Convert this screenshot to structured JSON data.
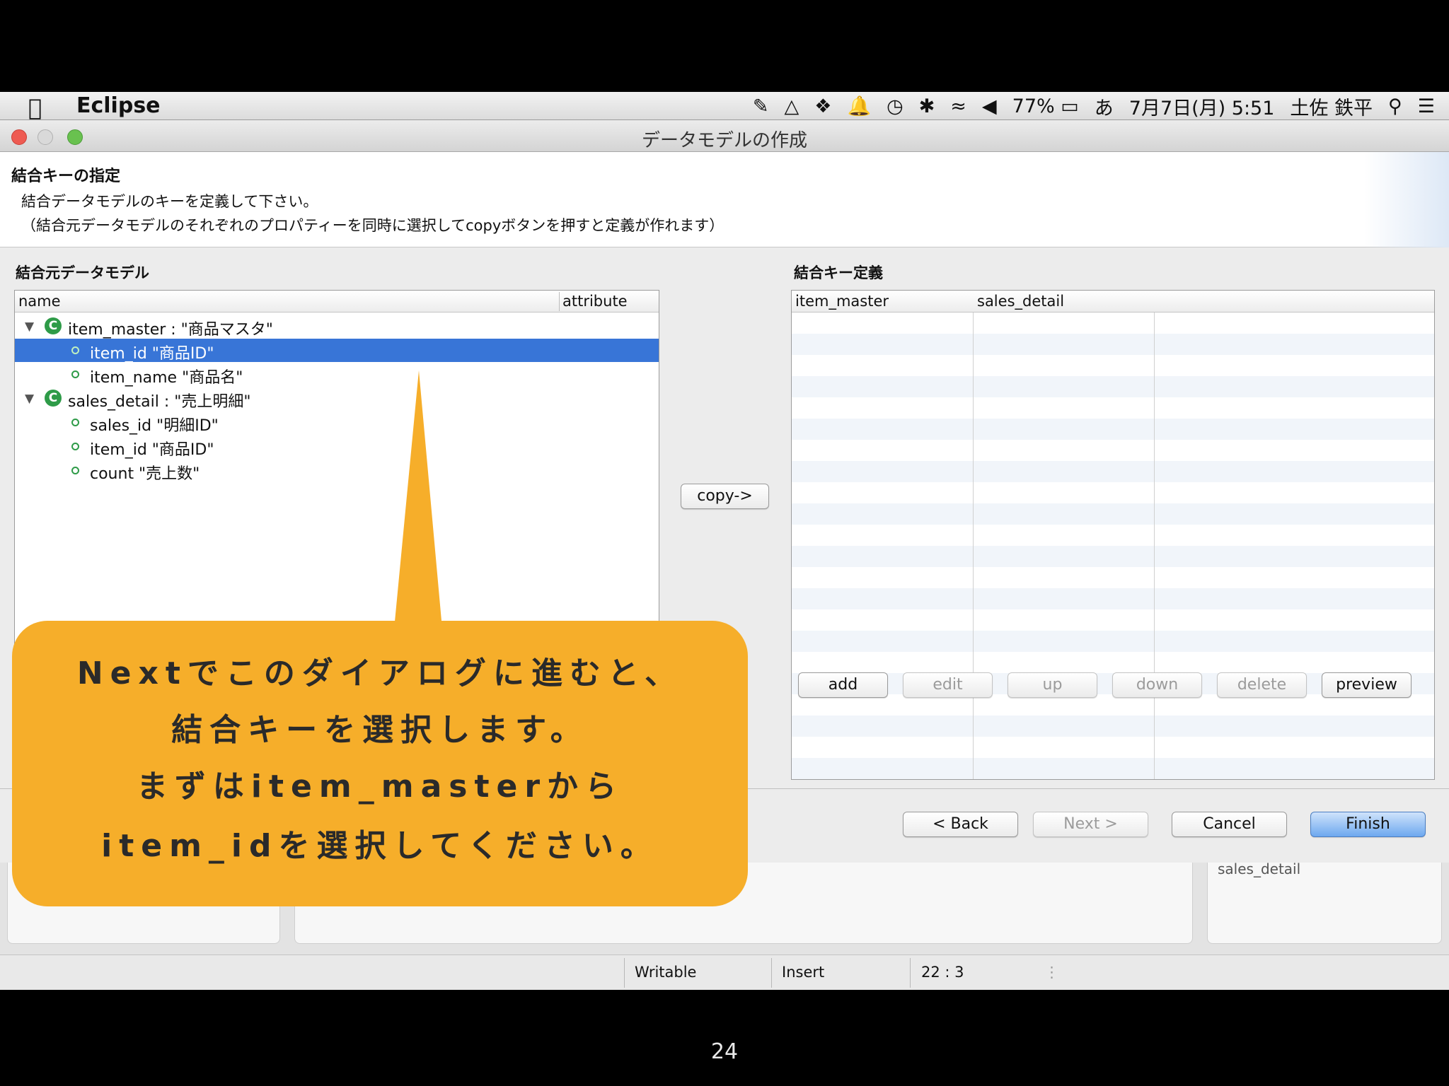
{
  "menubar": {
    "app_name": "Eclipse",
    "battery": "77%",
    "input_method": "あ",
    "datetime": "7月7日(月) 5:51",
    "user": "土佐 鉄平"
  },
  "window": {
    "title": "データモデルの作成"
  },
  "header": {
    "title": "結合キーの指定",
    "desc1": "結合データモデルのキーを定義して下さい。",
    "desc2": "（結合元データモデルのそれぞれのプロパティーを同時に選択してcopyボタンを押すと定義が作れます）"
  },
  "source_panel": {
    "label": "結合元データモデル",
    "columns": [
      "name",
      "attribute"
    ],
    "rows": [
      {
        "text": "item_master : \"商品マスタ\"",
        "kind": "model",
        "selected": false
      },
      {
        "text": "item_id \"商品ID\"",
        "kind": "property",
        "selected": true
      },
      {
        "text": "item_name \"商品名\"",
        "kind": "property",
        "selected": false
      },
      {
        "text": "sales_detail : \"売上明細\"",
        "kind": "model",
        "selected": false
      },
      {
        "text": "sales_id \"明細ID\"",
        "kind": "property",
        "selected": false
      },
      {
        "text": "item_id \"商品ID\"",
        "kind": "property",
        "selected": false
      },
      {
        "text": "count \"売上数\"",
        "kind": "property",
        "selected": false
      }
    ]
  },
  "copy_button": "copy->",
  "key_panel": {
    "label": "結合キー定義",
    "columns": [
      "item_master",
      "sales_detail"
    ]
  },
  "key_buttons": {
    "add": "add",
    "edit": "edit",
    "up": "up",
    "down": "down",
    "delete": "delete",
    "preview": "preview"
  },
  "nav_buttons": {
    "back": "< Back",
    "next": "Next >",
    "cancel": "Cancel",
    "finish": "Finish"
  },
  "statusbar": {
    "writable": "Writable",
    "insert": "Insert",
    "position": "22 : 3"
  },
  "background_text": "sales_detail",
  "callout": {
    "line1": "Nextでこのダイアログに進むと、",
    "line2": "結合キーを選択します。",
    "line3": "まずはitem_masterから",
    "line4": "item_idを選択してください。"
  },
  "page_number": "24",
  "colors": {
    "callout": "#f6ae2a",
    "selection": "#3875d7",
    "model_icon": "#2e9b48"
  }
}
